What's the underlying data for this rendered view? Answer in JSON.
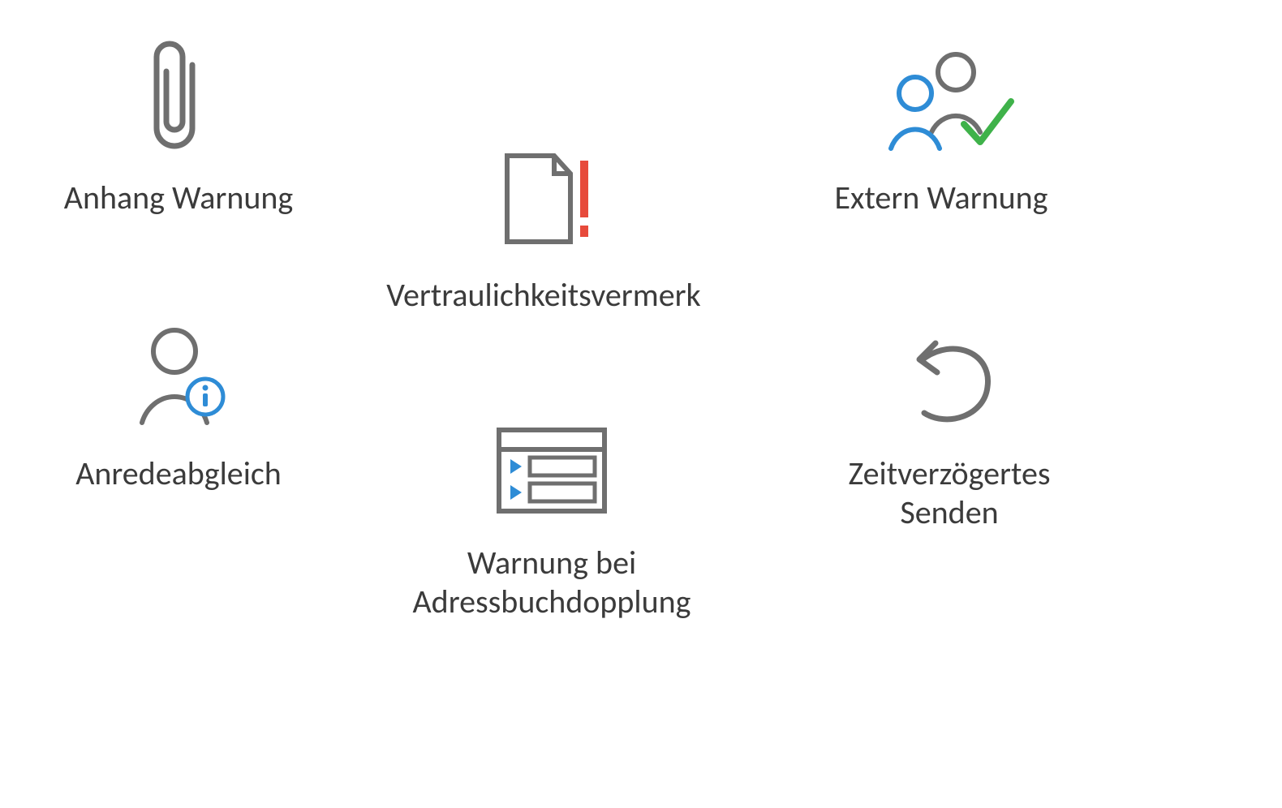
{
  "items": {
    "attachment_warning": {
      "label": "Anhang Warnung"
    },
    "confidentiality": {
      "label": "Vertraulichkeitsvermerk"
    },
    "external_warning": {
      "label": "Extern Warnung"
    },
    "salutation_check": {
      "label": "Anredeabgleich"
    },
    "addressbook_dup": {
      "label": "Warnung bei\nAdressbuchdopplung"
    },
    "delayed_send": {
      "label": "Zeitverzögertes\nSenden"
    }
  },
  "colors": {
    "stroke": "#6f6f6f",
    "accent_blue": "#2e8cd6",
    "accent_green": "#3fb24a",
    "accent_red": "#e74a3b"
  }
}
